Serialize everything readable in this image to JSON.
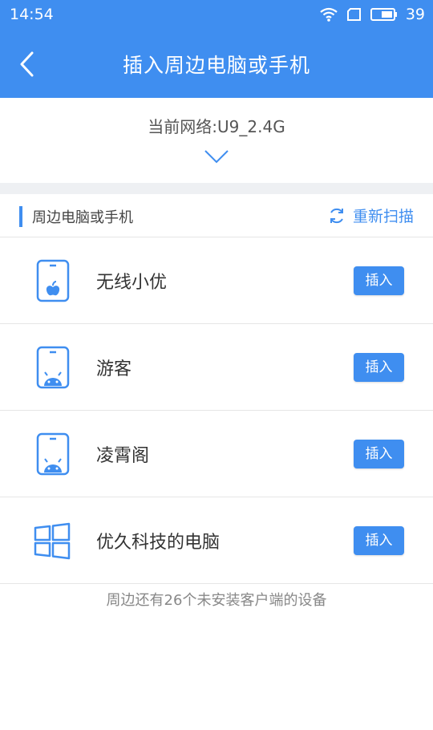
{
  "status_bar": {
    "time": "14:54",
    "battery": "39",
    "icons": [
      "wifi-icon",
      "sim-icon",
      "battery-icon"
    ]
  },
  "header": {
    "title": "插入周边电脑或手机",
    "back_icon": "chevron-left-icon"
  },
  "network": {
    "label": "当前网络:U9_2.4G",
    "expand_icon": "chevron-down-icon"
  },
  "section": {
    "title": "周边电脑或手机",
    "rescan_label": "重新扫描",
    "rescan_icon": "refresh-icon"
  },
  "devices": [
    {
      "name": "无线小优",
      "icon": "apple-tablet-icon",
      "action": "插入"
    },
    {
      "name": "游客",
      "icon": "android-tablet-icon",
      "action": "插入"
    },
    {
      "name": "凌霄阁",
      "icon": "android-tablet-icon",
      "action": "插入"
    },
    {
      "name": "优久科技的电脑",
      "icon": "windows-icon",
      "action": "插入"
    }
  ],
  "footer": {
    "note": "周边还有26个未安装客户端的设备"
  },
  "colors": {
    "accent": "#3f8ef0",
    "divider": "#e6e6e6",
    "background_gap": "#eef0f3"
  }
}
